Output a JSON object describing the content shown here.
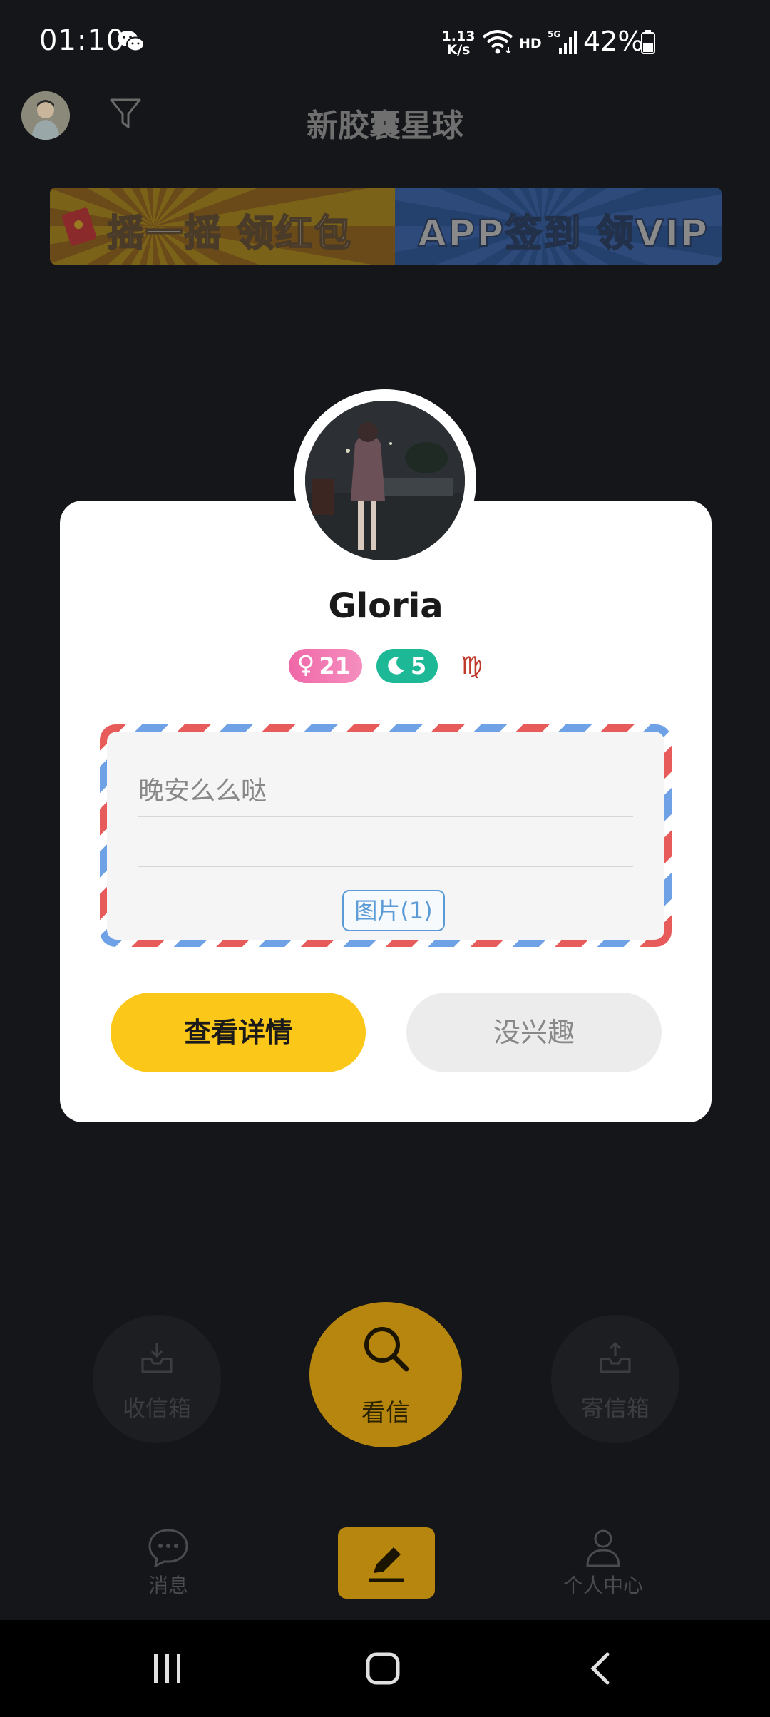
{
  "status_bar": {
    "time": "01:10",
    "net_speed_value": "1.13",
    "net_speed_unit": "K/s",
    "hd": "HD",
    "signal": "5G",
    "battery": "42%"
  },
  "header": {
    "title": "新胶囊星球"
  },
  "banner": {
    "left_text": "摇一摇 领红包",
    "right_text": "APP签到 领VIP"
  },
  "profile": {
    "name": "Gloria",
    "age": "21",
    "moon_count": "5",
    "zodiac_symbol": "♍"
  },
  "letter": {
    "text": "晚安么么哒",
    "attachment_label": "图片(1)"
  },
  "actions": {
    "detail_label": "查看详情",
    "skip_label": "没兴趣"
  },
  "mailbox": {
    "inbox_label": "收信箱",
    "read_label": "看信",
    "outbox_label": "寄信箱"
  },
  "bottom_nav": {
    "messages_label": "消息",
    "profile_label": "个人中心"
  },
  "colors": {
    "background": "#15161a",
    "accent_yellow": "#fbc719",
    "age_pink": "#f067a8",
    "moon_green": "#1db996",
    "stamp_red": "#e85b5b",
    "stamp_blue": "#6fa1e6"
  }
}
